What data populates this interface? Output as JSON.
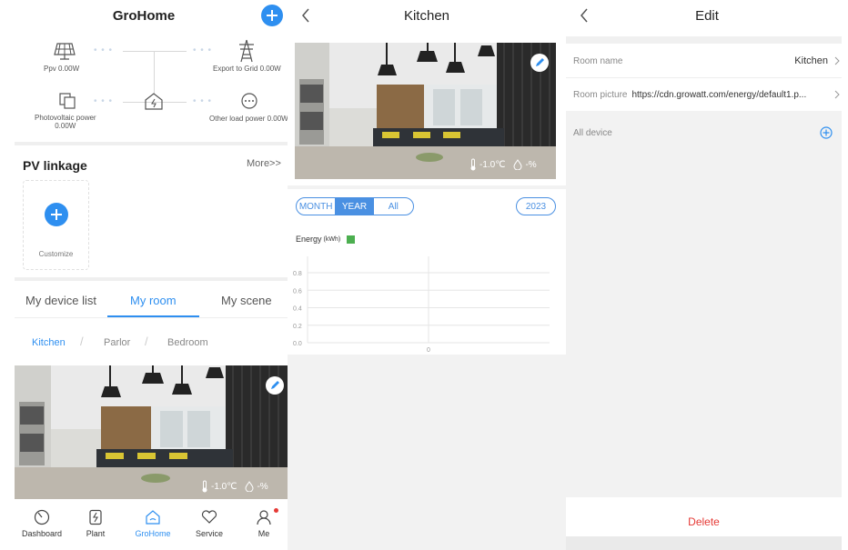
{
  "panel1": {
    "header": {
      "title": "GroHome"
    },
    "energy_flow": {
      "ppv": "Ppv 0.00W",
      "export": "Export to Grid 0.00W",
      "pv_power_label": "Photovoltaic power",
      "pv_power_value": "0.00W",
      "other_load": "Other load power 0.00W"
    },
    "pv_linkage": {
      "title": "PV linkage",
      "more": "More>>",
      "customize": "Customize"
    },
    "tabs": [
      "My device list",
      "My room",
      "My scene"
    ],
    "rooms": [
      "Kitchen",
      "Parlor",
      "Bedroom"
    ],
    "room_card": {
      "temperature": "-1.0℃",
      "humidity": "-%"
    },
    "bottom_nav": [
      {
        "label": "Dashboard",
        "icon": "dashboard-icon"
      },
      {
        "label": "Plant",
        "icon": "plant-icon"
      },
      {
        "label": "GroHome",
        "icon": "grohome-icon"
      },
      {
        "label": "Service",
        "icon": "service-icon"
      },
      {
        "label": "Me",
        "icon": "me-icon"
      }
    ],
    "colors": {
      "accent": "#2e8ff0",
      "badge": "#e53935"
    }
  },
  "panel2": {
    "header": {
      "title": "Kitchen"
    },
    "room_card": {
      "temperature": "-1.0℃",
      "humidity": "-%"
    },
    "period_tabs": [
      "MONTH",
      "YEAR",
      "All"
    ],
    "selected_period": "YEAR",
    "year": "2023",
    "legend": {
      "label": "Energy",
      "unit": "(kWh)",
      "color": "#4caf50"
    },
    "chart_data": {
      "type": "bar",
      "categories": [
        "0"
      ],
      "series": [
        {
          "name": "Energy(kWh)",
          "values": [
            0
          ]
        }
      ],
      "ylim": [
        0,
        0.8
      ],
      "yticks": [
        "0.8",
        "0.6",
        "0.4",
        "0.2",
        "0.0"
      ],
      "xticks": [
        "0"
      ],
      "grid": true
    }
  },
  "panel3": {
    "header": {
      "title": "Edit"
    },
    "room_name_label": "Room name",
    "room_name_value": "Kitchen",
    "room_picture_label": "Room picture",
    "room_picture_value": "https://cdn.growatt.com/energy/default1.p...",
    "all_device_label": "All device",
    "delete_label": "Delete",
    "colors": {
      "delete": "#e53935",
      "accent": "#2e8ff0"
    }
  }
}
